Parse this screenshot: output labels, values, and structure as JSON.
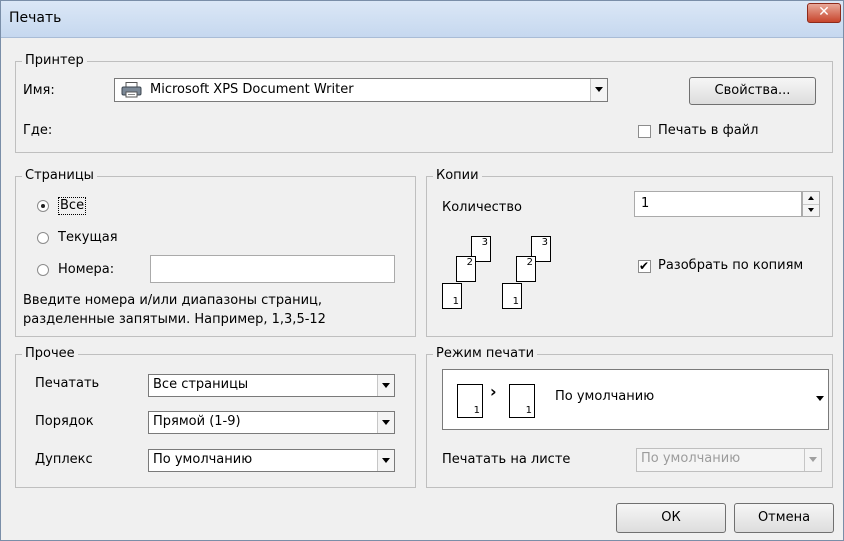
{
  "window": {
    "title": "Печать",
    "close_icon": "✕"
  },
  "printer": {
    "legend": "Принтер",
    "name_label": "Имя:",
    "name_value": "Microsoft XPS Document Writer",
    "where_label": "Где:",
    "properties_button": "Свойства...",
    "print_to_file_label": "Печать в файл",
    "print_to_file_checked": false,
    "printer_icon": "printer-icon"
  },
  "pages": {
    "legend": "Страницы",
    "all_label": "Все",
    "current_label": "Текущая",
    "numbers_label": "Номера:",
    "numbers_value": "",
    "selected": "all",
    "hint_line1": "Введите номера и/или диапазоны страниц,",
    "hint_line2": "разделенные запятыми. Например, 1,3,5-12"
  },
  "copies": {
    "legend": "Копии",
    "count_label": "Количество",
    "count_value": "1",
    "collate_label": "Разобрать по копиям",
    "collate_checked": true,
    "page_numbers": [
      "3",
      "2",
      "1"
    ]
  },
  "other": {
    "legend": "Прочее",
    "print_label": "Печатать",
    "print_value": "Все страницы",
    "order_label": "Порядок",
    "order_value": "Прямой (1-9)",
    "duplex_label": "Дуплекс",
    "duplex_value": "По умолчанию"
  },
  "print_mode": {
    "legend": "Режим печати",
    "mode_value": "По умолчанию",
    "mode_page_from": "1",
    "mode_page_to": "1",
    "mode_arrow": "›",
    "sheet_label": "Печатать на листе",
    "sheet_value": "По умолчанию"
  },
  "footer": {
    "ok_button": "ОК",
    "cancel_button": "Отмена"
  }
}
